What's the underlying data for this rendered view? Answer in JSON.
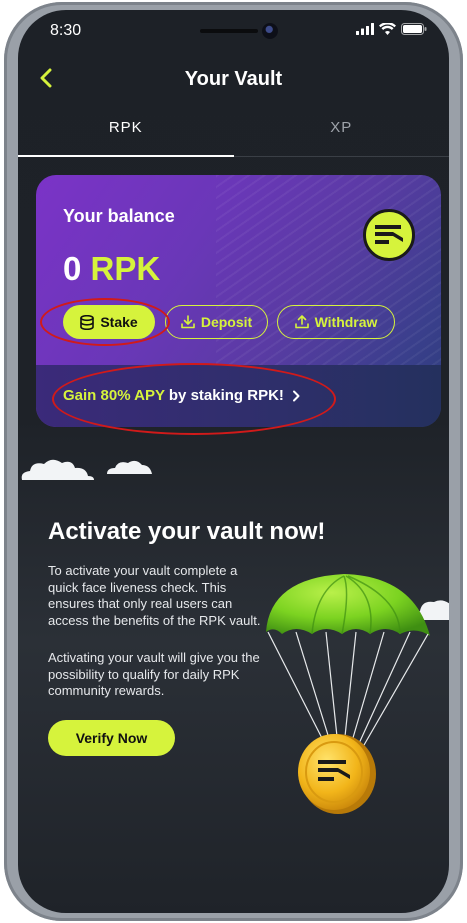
{
  "status_bar": {
    "time": "8:30"
  },
  "header": {
    "title": "Your Vault"
  },
  "tabs": [
    {
      "label": "RPK",
      "active": true
    },
    {
      "label": "XP",
      "active": false
    }
  ],
  "balance_card": {
    "label": "Your balance",
    "amount": "0",
    "unit": "RPK",
    "buttons": {
      "stake": "Stake",
      "deposit": "Deposit",
      "withdraw": "Withdraw"
    },
    "promo": {
      "highlight": "Gain 80% APY",
      "rest": "by staking RPK!"
    }
  },
  "activate": {
    "title": "Activate your vault now!",
    "paragraph1": "To activate your vault complete a quick face liveness check. This ensures that only real users can access the benefits of the RPK vault.",
    "paragraph2": "Activating your vault will give you the possibility to qualify for daily RPK community rewards.",
    "cta": "Verify Now"
  },
  "colors": {
    "accent": "#d6f33c",
    "background": "#1d2127",
    "card_gradient_start": "#7b33c7",
    "annotation": "#d11a1a"
  },
  "icons": [
    "chevron-left-icon",
    "database-icon",
    "download-icon",
    "upload-icon",
    "chevron-right-icon",
    "vault-logo-icon",
    "signal-icon",
    "wifi-icon",
    "battery-icon"
  ]
}
